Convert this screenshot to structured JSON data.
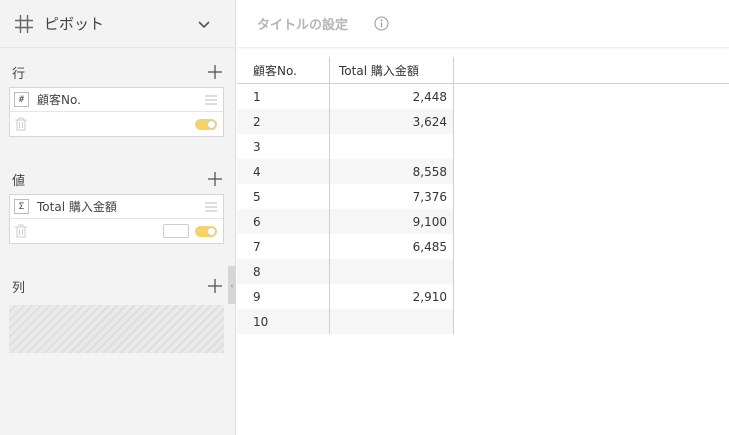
{
  "panel": {
    "title": "ピボット",
    "sections": {
      "rows": {
        "label": "行",
        "field": {
          "type": "#",
          "name": "顧客No."
        }
      },
      "values": {
        "label": "値",
        "field": {
          "type": "Σ",
          "name": "Total 購入金額"
        }
      },
      "columns": {
        "label": "列"
      }
    }
  },
  "view": {
    "title_placeholder": "タイトルの設定"
  },
  "table": {
    "headers": [
      "顧客No.",
      "Total 購入金額"
    ],
    "rows": [
      [
        "1",
        "2,448"
      ],
      [
        "2",
        "3,624"
      ],
      [
        "3",
        ""
      ],
      [
        "4",
        "8,558"
      ],
      [
        "5",
        "7,376"
      ],
      [
        "6",
        "9,100"
      ],
      [
        "7",
        "6,485"
      ],
      [
        "8",
        ""
      ],
      [
        "9",
        "2,910"
      ],
      [
        "10",
        ""
      ]
    ]
  },
  "colors": {
    "toggle_on": "#f6d26b",
    "panel_bg": "#f3f3f3",
    "title_gray": "#b5b5b5"
  }
}
